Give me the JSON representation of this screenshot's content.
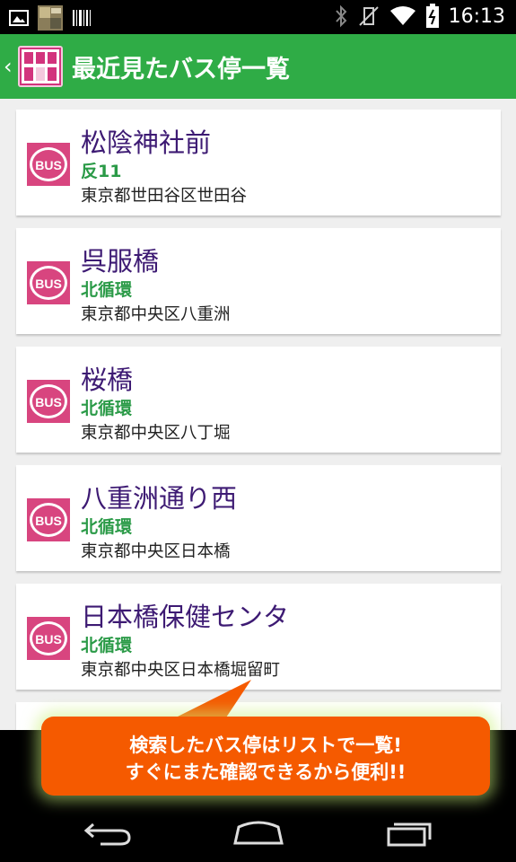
{
  "status_bar": {
    "time": "16:13",
    "left_icons": [
      "picture-icon",
      "app-thumbnail-icon",
      "barcode-icon"
    ],
    "right_icons": [
      "bluetooth-icon",
      "vibrate-off-icon",
      "wifi-icon",
      "battery-icon"
    ]
  },
  "action_bar": {
    "title": "最近見たバス停一覧",
    "color": "#2fac46"
  },
  "stops": [
    {
      "name": "松陰神社前",
      "route": "反11",
      "address": "東京都世田谷区世田谷"
    },
    {
      "name": "呉服橋",
      "route": "北循環",
      "address": "東京都中央区八重洲"
    },
    {
      "name": "桜橋",
      "route": "北循環",
      "address": "東京都中央区八丁堀"
    },
    {
      "name": "八重洲通り西",
      "route": "北循環",
      "address": "東京都中央区日本橋"
    },
    {
      "name": "日本橋保健センタ",
      "route": "北循環",
      "address": "東京都中央区日本橋堀留町"
    }
  ],
  "bus_icon_label": "BUS",
  "callout": {
    "line1": "検索したバス停はリストで一覧!",
    "line2": "すぐにまた確認できるから便利!!",
    "color": "#f55a00"
  },
  "nav_bar": {
    "buttons": [
      "back-icon",
      "home-icon",
      "recent-apps-icon"
    ]
  }
}
